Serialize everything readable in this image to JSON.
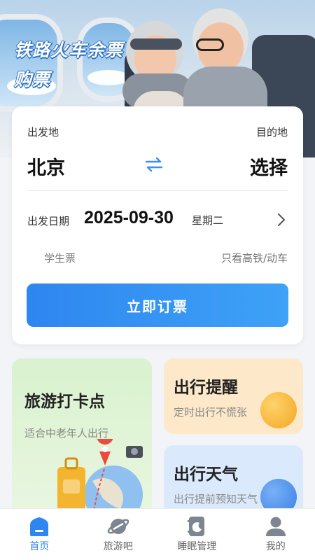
{
  "banner": {
    "line1": "铁路火车余票",
    "line2": "购票"
  },
  "booking": {
    "from_label": "出发地",
    "to_label": "目的地",
    "from_city": "北京",
    "to_city": "选择",
    "date_label": "出发日期",
    "date": "2025-09-30",
    "weekday": "星期二",
    "option_student": "学生票",
    "option_highspeed": "只看高铁/动车",
    "book_button": "立即订票"
  },
  "tiles": {
    "travel": {
      "title": "旅游打卡点",
      "subtitle": "适合中老年人出行"
    },
    "remind": {
      "title": "出行提醒",
      "subtitle": "定时出行不慌张"
    },
    "weather": {
      "title": "出行天气",
      "subtitle": "出行提前预知天气"
    }
  },
  "nav": [
    {
      "label": "首页",
      "icon": "home-icon",
      "active": true
    },
    {
      "label": "旅游吧",
      "icon": "planet-icon",
      "active": false
    },
    {
      "label": "睡眠管理",
      "icon": "sleep-icon",
      "active": false
    },
    {
      "label": "我的",
      "icon": "user-icon",
      "active": false
    }
  ],
  "colors": {
    "accent": "#2e86f0",
    "remind_orb": "#f8b72b",
    "weather_orb": "#4a8ff0"
  }
}
